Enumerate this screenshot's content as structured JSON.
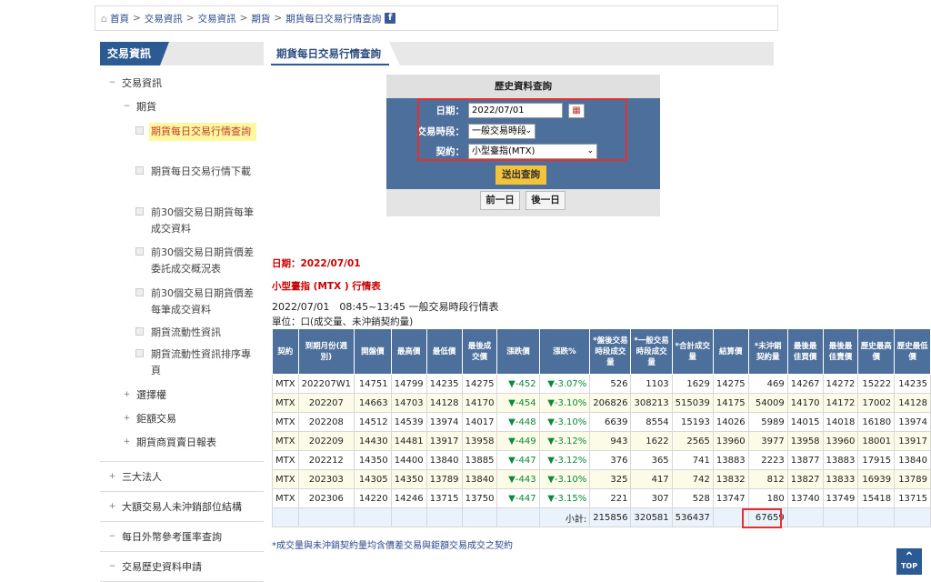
{
  "breadcrumb": [
    "首頁",
    "交易資訊",
    "交易資訊",
    "期貨",
    "期貨每日交易行情查詢"
  ],
  "sidebar": {
    "tab": "交易資訊",
    "root": "交易資訊",
    "group": "期貨",
    "items": [
      {
        "label": "期貨每日交易行情查詢",
        "active": true
      },
      {
        "label": "期貨每日交易行情下載"
      },
      {
        "label": "前30個交易日期貨每筆成交資料"
      },
      {
        "label": "前30個交易日期貨價差委託成交概況表"
      },
      {
        "label": "前30個交易日期貨價差每筆成交資料"
      },
      {
        "label": "期貨流動性資訊"
      },
      {
        "label": "期貨流動性資訊排序專頁"
      }
    ],
    "collapsed": [
      "選擇權",
      "鉅額交易",
      "期貨商買賣日報表"
    ],
    "sections": [
      "三大法人",
      "大額交易人未沖銷部位結構",
      "每日外幣參考匯率查詢",
      "交易歷史資料申請"
    ]
  },
  "main": {
    "tab": "期貨每日交易行情查詢",
    "query": {
      "title": "歷史資料查詢",
      "date_label": "日期：",
      "date_value": "2022/07/01",
      "session_label": "交易時段：",
      "session_value": "一般交易時段",
      "contract_label": "契約：",
      "contract_value": "小型臺指(MTX)",
      "submit": "送出查詢",
      "prev": "前一日",
      "next": "後一日"
    },
    "info": {
      "date": "日期：2022/07/01",
      "contract": "小型臺指 (MTX ) 行情表",
      "session": "2022/07/01　08:45~13:45 一般交易時段行情表",
      "unit": "單位：口(成交量、未沖銷契約量)"
    },
    "table": {
      "headers": [
        "契約",
        "到期月份(週別)",
        "開盤價",
        "最高價",
        "最低價",
        "最後成交價",
        "漲跌價",
        "漲跌%",
        "*盤後交易時段成交量",
        "*一般交易時段成交量",
        "*合計成交量",
        "結算價",
        "*未沖銷契約量",
        "最後最佳買價",
        "最後最佳賣價",
        "歷史最高價",
        "歷史最低價"
      ],
      "rows": [
        [
          "MTX",
          "202207W1",
          "14751",
          "14799",
          "14235",
          "14275",
          "▼-452",
          "▼-3.07%",
          "526",
          "1103",
          "1629",
          "14275",
          "469",
          "14267",
          "14272",
          "15222",
          "14235"
        ],
        [
          "MTX",
          "202207",
          "14663",
          "14703",
          "14128",
          "14170",
          "▼-454",
          "▼-3.10%",
          "206826",
          "308213",
          "515039",
          "14175",
          "54009",
          "14170",
          "14172",
          "17002",
          "14128"
        ],
        [
          "MTX",
          "202208",
          "14512",
          "14539",
          "13974",
          "14017",
          "▼-448",
          "▼-3.10%",
          "6639",
          "8554",
          "15193",
          "14026",
          "5989",
          "14015",
          "14018",
          "16180",
          "13974"
        ],
        [
          "MTX",
          "202209",
          "14430",
          "14481",
          "13917",
          "13958",
          "▼-449",
          "▼-3.12%",
          "943",
          "1622",
          "2565",
          "13960",
          "3977",
          "13958",
          "13960",
          "18001",
          "13917"
        ],
        [
          "MTX",
          "202212",
          "14350",
          "14400",
          "13840",
          "13885",
          "▼-447",
          "▼-3.12%",
          "376",
          "365",
          "741",
          "13883",
          "2223",
          "13877",
          "13883",
          "17915",
          "13840"
        ],
        [
          "MTX",
          "202303",
          "14305",
          "14350",
          "13789",
          "13840",
          "▼-443",
          "▼-3.10%",
          "325",
          "417",
          "742",
          "13832",
          "812",
          "13827",
          "13833",
          "16939",
          "13789"
        ],
        [
          "MTX",
          "202306",
          "14220",
          "14246",
          "13715",
          "13750",
          "▼-447",
          "▼-3.15%",
          "221",
          "307",
          "528",
          "13747",
          "180",
          "13740",
          "13749",
          "15418",
          "13715"
        ]
      ],
      "subtotal": {
        "label": "小計:",
        "after": "215856",
        "regular": "320581",
        "total": "536437",
        "oi": "67659"
      }
    },
    "footnote": "*成交量與未沖銷契約量均含價差交易與鉅額交易成交之契約",
    "top": "TOP"
  }
}
